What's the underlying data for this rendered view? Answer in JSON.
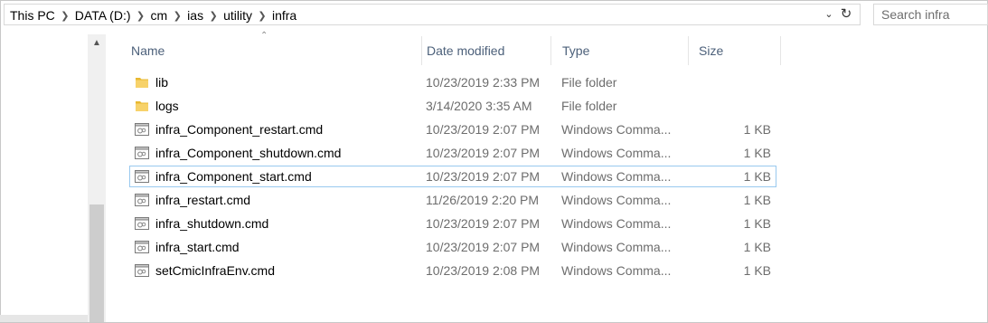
{
  "breadcrumb": {
    "items": [
      "This PC",
      "DATA (D:)",
      "cm",
      "ias",
      "utility",
      "infra"
    ]
  },
  "search": {
    "placeholder": "Search infra"
  },
  "columns": {
    "name": "Name",
    "date": "Date modified",
    "type": "Type",
    "size": "Size"
  },
  "files": [
    {
      "name": "lib",
      "date": "10/23/2019 2:33 PM",
      "type": "File folder",
      "size": "",
      "icon": "folder-icon"
    },
    {
      "name": "logs",
      "date": "3/14/2020 3:35 AM",
      "type": "File folder",
      "size": "",
      "icon": "folder-icon"
    },
    {
      "name": "infra_Component_restart.cmd",
      "date": "10/23/2019 2:07 PM",
      "type": "Windows Comma...",
      "size": "1 KB",
      "icon": "cmd-file-icon"
    },
    {
      "name": "infra_Component_shutdown.cmd",
      "date": "10/23/2019 2:07 PM",
      "type": "Windows Comma...",
      "size": "1 KB",
      "icon": "cmd-file-icon"
    },
    {
      "name": "infra_Component_start.cmd",
      "date": "10/23/2019 2:07 PM",
      "type": "Windows Comma...",
      "size": "1 KB",
      "icon": "cmd-file-icon"
    },
    {
      "name": "infra_restart.cmd",
      "date": "11/26/2019 2:20 PM",
      "type": "Windows Comma...",
      "size": "1 KB",
      "icon": "cmd-file-icon"
    },
    {
      "name": "infra_shutdown.cmd",
      "date": "10/23/2019 2:07 PM",
      "type": "Windows Comma...",
      "size": "1 KB",
      "icon": "cmd-file-icon"
    },
    {
      "name": "infra_start.cmd",
      "date": "10/23/2019 2:07 PM",
      "type": "Windows Comma...",
      "size": "1 KB",
      "icon": "cmd-file-icon"
    },
    {
      "name": "setCmicInfraEnv.cmd",
      "date": "10/23/2019 2:08 PM",
      "type": "Windows Comma...",
      "size": "1 KB",
      "icon": "cmd-file-icon"
    }
  ],
  "focused_row": 4,
  "colors": {
    "header_text": "#4c607a",
    "focus_border": "#99c9ef",
    "folder": "#f5c842"
  }
}
